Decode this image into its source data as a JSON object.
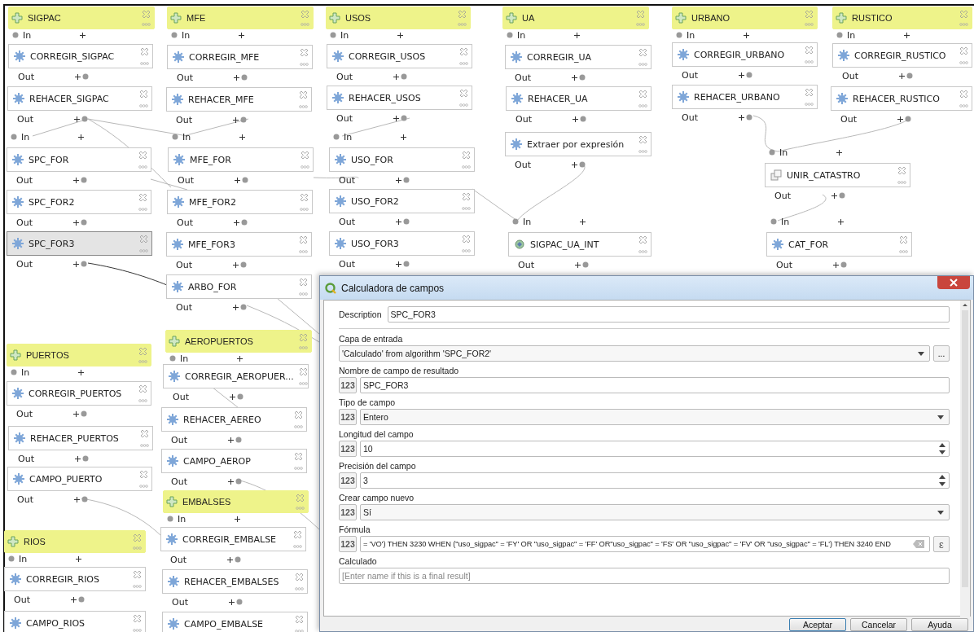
{
  "nodes": [
    {
      "kind": "input",
      "label": "SIGPAC",
      "below": "In",
      "selected": false
    },
    {
      "kind": "algorithm",
      "label": "CORREGIR_SIGPAC",
      "below": "Out",
      "selected": false
    },
    {
      "kind": "algorithm",
      "label": "REHACER_SIGPAC",
      "below": "Out",
      "selected": false
    },
    {
      "kind": "algorithm",
      "label": "SPC_FOR",
      "above": "In",
      "below": "Out",
      "selected": false
    },
    {
      "kind": "algorithm",
      "label": "SPC_FOR2",
      "below": "Out",
      "selected": false
    },
    {
      "kind": "algorithm",
      "label": "SPC_FOR3",
      "below": "Out",
      "selected": true
    },
    {
      "kind": "input",
      "label": "MFE",
      "below": "In",
      "selected": false
    },
    {
      "kind": "algorithm",
      "label": "CORREGIR_MFE",
      "below": "Out",
      "selected": false
    },
    {
      "kind": "algorithm",
      "label": "REHACER_MFE",
      "below": "Out",
      "selected": false
    },
    {
      "kind": "algorithm",
      "label": "MFE_FOR",
      "above": "In",
      "below": "Out",
      "selected": false
    },
    {
      "kind": "algorithm",
      "label": "MFE_FOR2",
      "below": "Out",
      "selected": false
    },
    {
      "kind": "algorithm",
      "label": "MFE_FOR3",
      "below": "Out",
      "selected": false
    },
    {
      "kind": "algorithm",
      "label": "ARBO_FOR",
      "below": "Out",
      "selected": false
    },
    {
      "kind": "input",
      "label": "PUERTOS",
      "below": "In",
      "selected": false
    },
    {
      "kind": "algorithm",
      "label": "CORREGIR_PUERTOS",
      "below": "Out",
      "selected": false
    },
    {
      "kind": "algorithm",
      "label": "REHACER_PUERTOS",
      "below": "Out",
      "selected": false
    },
    {
      "kind": "algorithm",
      "label": "CAMPO_PUERTO",
      "below": "Out",
      "selected": false
    },
    {
      "kind": "input",
      "label": "RIOS",
      "below": "In",
      "selected": false
    },
    {
      "kind": "algorithm",
      "label": "CORREGIR_RIOS",
      "below": "Out",
      "selected": false
    },
    {
      "kind": "algorithm",
      "label": "CAMPO_RIOS",
      "selected": false
    },
    {
      "kind": "input",
      "label": "AEROPUERTOS",
      "below": "In",
      "selected": false
    },
    {
      "kind": "algorithm",
      "label": "CORREGIR_AEROPUER...",
      "below": "Out",
      "selected": false
    },
    {
      "kind": "algorithm",
      "label": "REHACER_AEREO",
      "below": "Out",
      "selected": false
    },
    {
      "kind": "algorithm",
      "label": "CAMPO_AEROP",
      "below": "Out",
      "selected": false
    },
    {
      "kind": "input",
      "label": "EMBALSES",
      "below": "In",
      "selected": false
    },
    {
      "kind": "algorithm",
      "label": "CORREGIR_EMBALSE",
      "below": "Out",
      "selected": false
    },
    {
      "kind": "algorithm",
      "label": "REHACER_EMBALSES",
      "below": "Out",
      "selected": false
    },
    {
      "kind": "algorithm",
      "label": "CAMPO_EMBALSE",
      "selected": false
    },
    {
      "kind": "input",
      "label": "USOS",
      "below": "In",
      "selected": false
    },
    {
      "kind": "algorithm",
      "label": "CORREGIR_USOS",
      "below": "Out",
      "selected": false
    },
    {
      "kind": "algorithm",
      "label": "REHACER_USOS",
      "below": "Out",
      "selected": false
    },
    {
      "kind": "algorithm",
      "label": "USO_FOR",
      "above": "In",
      "below": "Out",
      "selected": false
    },
    {
      "kind": "algorithm",
      "label": "USO_FOR2",
      "below": "Out",
      "selected": false
    },
    {
      "kind": "algorithm",
      "label": "USO_FOR3",
      "below": "Out",
      "selected": false
    },
    {
      "kind": "input",
      "label": "UA",
      "below": "In",
      "selected": false
    },
    {
      "kind": "algorithm",
      "label": "CORREGIR_UA",
      "below": "Out",
      "selected": false
    },
    {
      "kind": "algorithm",
      "label": "REHACER_UA",
      "below": "Out",
      "selected": false
    },
    {
      "kind": "algorithm",
      "label": "Extraer por expresión",
      "below": "Out",
      "selected": false
    },
    {
      "kind": "intersect",
      "label": "SIGPAC_UA_INT",
      "above": "In",
      "below": "Out",
      "selected": false
    },
    {
      "kind": "input",
      "label": "URBANO",
      "below": "In",
      "selected": false
    },
    {
      "kind": "algorithm",
      "label": "CORREGIR_URBANO",
      "below": "Out",
      "selected": false
    },
    {
      "kind": "algorithm",
      "label": "REHACER_URBANO",
      "below": "Out",
      "selected": false
    },
    {
      "kind": "merge",
      "label": "UNIR_CATASTRO",
      "above": "In",
      "below": "Out",
      "selected": false
    },
    {
      "kind": "algorithm",
      "label": "CAT_FOR",
      "above": "In",
      "below": "Out",
      "selected": false
    },
    {
      "kind": "input",
      "label": "RUSTICO",
      "below": "In",
      "selected": false
    },
    {
      "kind": "algorithm",
      "label": "CORREGIR_RUSTICO",
      "below": "Out",
      "selected": false
    },
    {
      "kind": "algorithm",
      "label": "REHACER_RUSTICO",
      "below": "Out",
      "selected": false
    }
  ],
  "dialog": {
    "title": "Calculadora de campos",
    "fields": [
      {
        "kind": "inline",
        "label": "Description",
        "value": "SPC_FOR3"
      },
      {
        "kind": "combo-browse",
        "label": "Capa de entrada",
        "value": "'Calculado' from algorithm 'SPC_FOR2'",
        "button": "..."
      },
      {
        "kind": "text",
        "label": "Nombre de campo de resultado",
        "badge": "123",
        "value": "SPC_FOR3"
      },
      {
        "kind": "combo",
        "label": "Tipo de campo",
        "badge": "123",
        "value": "Entero"
      },
      {
        "kind": "spin",
        "label": "Longitud del campo",
        "badge": "123",
        "value": "10"
      },
      {
        "kind": "spin",
        "label": "Precisión del campo",
        "badge": "123",
        "value": "3"
      },
      {
        "kind": "combo",
        "label": "Crear campo nuevo",
        "badge": "123",
        "value": "Sí"
      },
      {
        "kind": "expression",
        "label": "Fórmula",
        "badge": "123",
        "value": "= 'VO') THEN 3230  WHEN (\"uso_sigpac\" = 'FY' OR \"uso_sigpac\" = 'FF' OR\"uso_sigpac\" = 'FS' OR \"uso_sigpac\" = 'FV' OR \"uso_sigpac\" = 'FL') THEN 3240  END",
        "button": "ε"
      },
      {
        "kind": "text",
        "label": "Calculado",
        "placeholder": "[Enter name if this is a final result]"
      }
    ],
    "buttons": [
      "Aceptar",
      "Cancelar",
      "Ayuda"
    ]
  }
}
